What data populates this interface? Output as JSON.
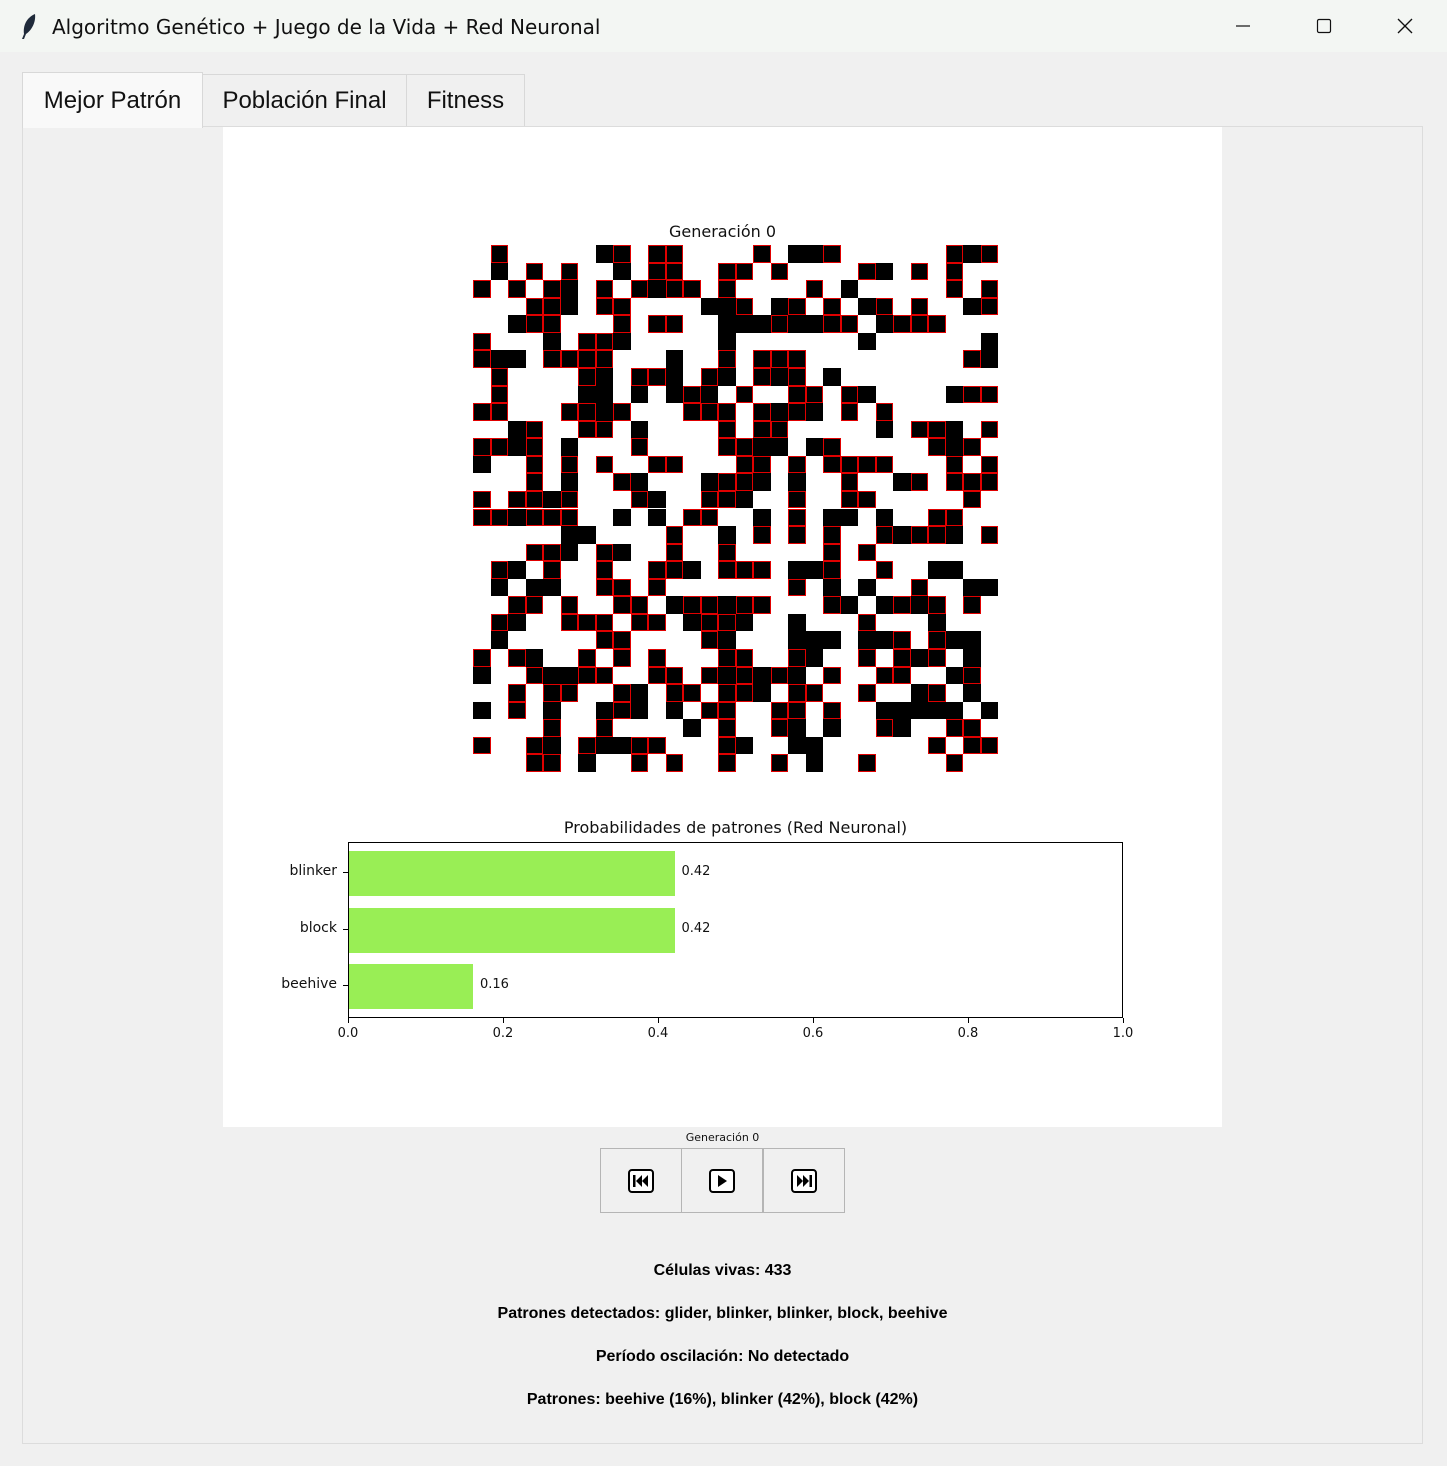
{
  "window": {
    "title": "Algoritmo Genético + Juego de la Vida + Red Neuronal",
    "icon": "feather-icon"
  },
  "tabs": [
    {
      "label": "Mejor Patrón",
      "active": true
    },
    {
      "label": "Población Final",
      "active": false
    },
    {
      "label": "Fitness",
      "active": false
    }
  ],
  "figure": {
    "grid_title": "Generación 0"
  },
  "chart_data": {
    "type": "bar",
    "orientation": "horizontal",
    "title": "Probabilidades de patrones (Red Neuronal)",
    "categories": [
      "blinker",
      "block",
      "beehive"
    ],
    "values": [
      0.42,
      0.42,
      0.16
    ],
    "value_labels": [
      "0.42",
      "0.42",
      "0.16"
    ],
    "xlim": [
      0.0,
      1.0
    ],
    "xticks": [
      "0.0",
      "0.2",
      "0.4",
      "0.6",
      "0.8",
      "1.0"
    ],
    "xlabel": "",
    "ylabel": "",
    "bar_color": "#99ee55",
    "grid": false
  },
  "controls": {
    "caption": "Generación 0",
    "buttons": [
      "skip-to-start-icon",
      "play-icon",
      "skip-to-end-icon"
    ]
  },
  "info": {
    "alive": "Células vivas: 433",
    "detected": "Patrones detectados: glider, blinker, blinker, block, beehive",
    "period": "Período oscilación: No detectado",
    "patterns": "Patrones: beehive (16%), blinker (42%), block (42%)"
  },
  "colors": {
    "alive_cell": "#000000",
    "pattern_outline": "#e00000",
    "background": "#f0f0f0"
  }
}
